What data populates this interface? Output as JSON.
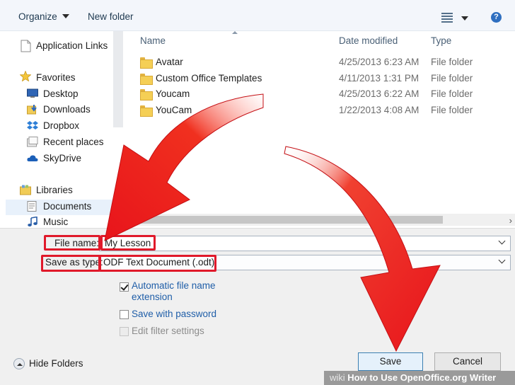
{
  "toolbar": {
    "organize_label": "Organize",
    "new_folder_label": "New folder",
    "help_label": "?"
  },
  "nav": {
    "application_links": "Application Links",
    "favorites": "Favorites",
    "favorites_items": [
      "Desktop",
      "Downloads",
      "Dropbox",
      "Recent places",
      "SkyDrive"
    ],
    "libraries": "Libraries",
    "library_items": [
      "Documents",
      "Music"
    ]
  },
  "columns": {
    "name": "Name",
    "date": "Date modified",
    "type": "Type"
  },
  "files": [
    {
      "name": "Avatar",
      "date": "4/25/2013 6:23 AM",
      "type": "File folder"
    },
    {
      "name": "Custom Office Templates",
      "date": "4/11/2013 1:31 PM",
      "type": "File folder"
    },
    {
      "name": "Youcam",
      "date": "4/25/2013 6:22 AM",
      "type": "File folder"
    },
    {
      "name": "YouCam",
      "date": "1/22/2013 4:08 AM",
      "type": "File folder"
    }
  ],
  "form": {
    "file_name_label": "File name:",
    "file_name_value": "My Lesson",
    "save_type_label": "Save as type:",
    "save_type_value": "ODF Text Document (.odt)",
    "auto_ext_label_1": "Automatic file name",
    "auto_ext_label_2": "extension",
    "auto_ext_checked": true,
    "save_password_label": "Save with password",
    "save_password_checked": false,
    "edit_filter_label": "Edit filter settings",
    "edit_filter_checked": false
  },
  "footer": {
    "hide_folders_label": "Hide Folders",
    "save_label": "Save",
    "cancel_label": "Cancel"
  },
  "watermark": {
    "prefix": "wiki",
    "text": "How to Use OpenOffice.org Writer"
  },
  "colors": {
    "highlight_red": "#e0192a",
    "arrow_red": "#e8141b",
    "link_blue": "#1f5ea8"
  }
}
